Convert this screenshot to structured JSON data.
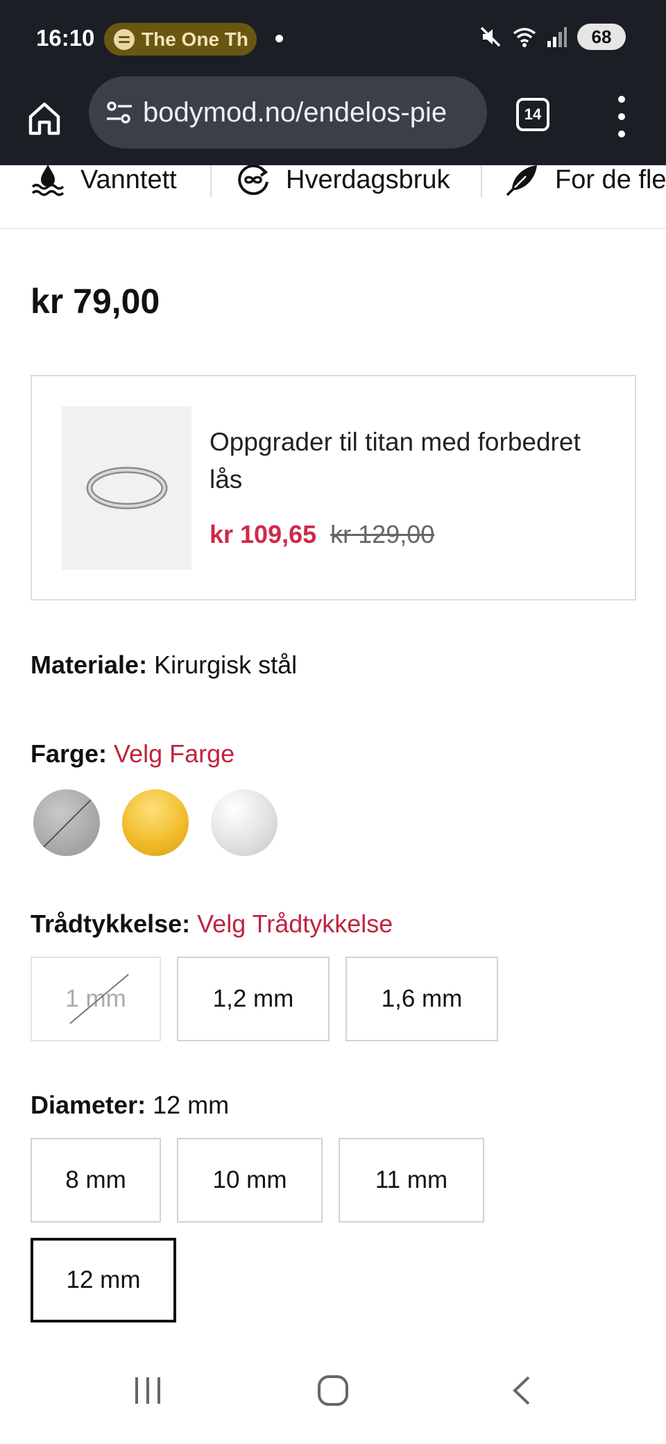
{
  "status_bar": {
    "time": "16:10",
    "media_text": "The One Th",
    "battery": "68",
    "icons": [
      "spotify-icon",
      "mute-icon",
      "wifi-icon",
      "signal-icon"
    ]
  },
  "browser": {
    "url": "bodymod.no/endelos-pie",
    "tab_count": "14",
    "icons": [
      "home-icon",
      "site-settings-icon",
      "tabs-icon",
      "more-menu-icon"
    ]
  },
  "features": [
    {
      "label": "Vanntett",
      "icon": "waterproof-icon"
    },
    {
      "label": "Hverdagsbruk",
      "icon": "everyday-use-icon"
    },
    {
      "label": "For de fle",
      "icon": "feather-icon"
    }
  ],
  "product": {
    "price": "kr 79,00"
  },
  "upsell": {
    "title": "Oppgrader til titan med forbedret lås",
    "sale_price": "kr 109,65",
    "original_price": "kr 129,00",
    "sale_color": "#d1284b"
  },
  "material": {
    "label": "Materiale:",
    "value": "Kirurgisk stål"
  },
  "color": {
    "label": "Farge:",
    "value": "Velg Farge",
    "swatches": [
      {
        "name": "silver",
        "available": false
      },
      {
        "name": "gold",
        "available": true
      },
      {
        "name": "white",
        "available": true
      }
    ]
  },
  "thickness": {
    "label": "Trådtykkelse:",
    "value": "Velg Trådtykkelse",
    "options": [
      {
        "label": "1 mm",
        "available": false
      },
      {
        "label": "1,2 mm",
        "available": true
      },
      {
        "label": "1,6 mm",
        "available": true
      }
    ]
  },
  "diameter": {
    "label": "Diameter:",
    "value": "12 mm",
    "options": [
      {
        "label": "8 mm",
        "selected": false
      },
      {
        "label": "10 mm",
        "selected": false
      },
      {
        "label": "11 mm",
        "selected": false
      },
      {
        "label": "12 mm",
        "selected": true
      }
    ]
  },
  "accent_color": "#c0233f",
  "nav_bar": {
    "icons": [
      "recent-apps-icon",
      "home-button-icon",
      "back-icon"
    ]
  }
}
